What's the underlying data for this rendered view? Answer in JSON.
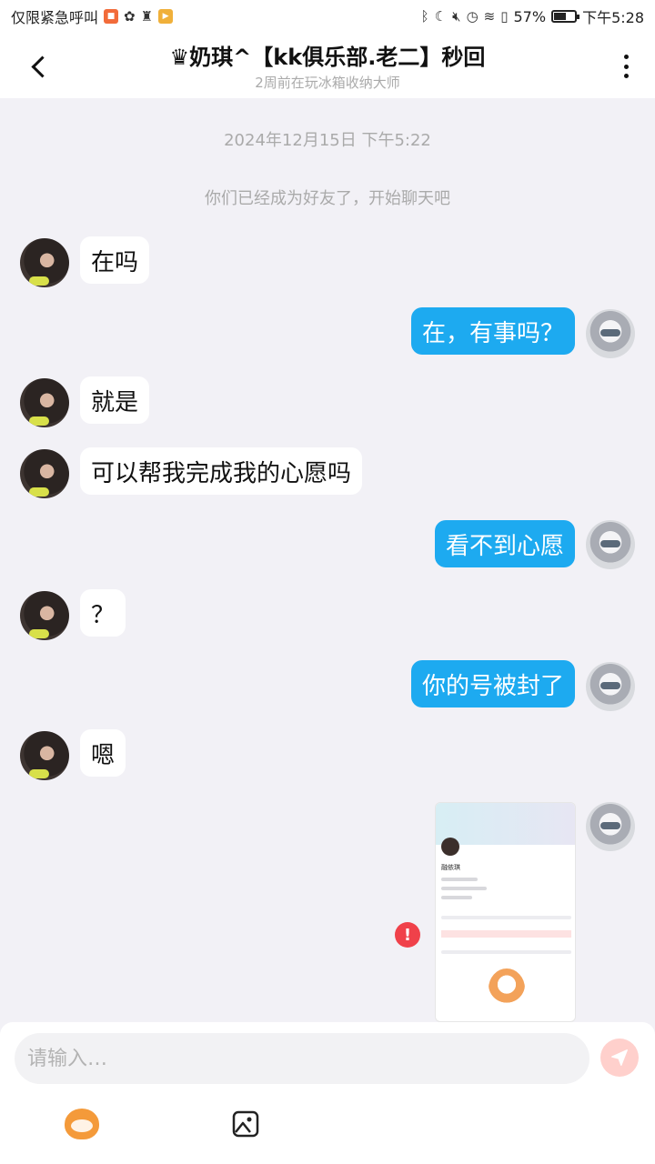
{
  "status_bar": {
    "left_text": "仅限紧急呼叫",
    "battery_percent": "57%",
    "battery_level": 0.57,
    "time": "下午5:28"
  },
  "header": {
    "title": "♛奶琪^【kk俱乐部.老二】秒回",
    "subtitle": "2周前在玩冰箱收纳大师"
  },
  "chat": {
    "timestamp": "2024年12月15日 下午5:22",
    "system_notice": "你们已经成为好友了，开始聊天吧",
    "messages": [
      {
        "from": "peer",
        "text": "在吗"
      },
      {
        "from": "me",
        "text": "在，有事吗？"
      },
      {
        "from": "peer",
        "text": "就是"
      },
      {
        "from": "peer",
        "text": "可以帮我完成我的心愿吗"
      },
      {
        "from": "me",
        "text": "看不到心愿"
      },
      {
        "from": "peer",
        "text": "？"
      },
      {
        "from": "me",
        "text": "你的号被封了"
      },
      {
        "from": "peer",
        "text": "嗯"
      }
    ],
    "image_message": {
      "profile_name": "融依琪",
      "error_icon": "!"
    }
  },
  "input": {
    "placeholder": "请输入…"
  },
  "colors": {
    "my_bubble": "#1daaf0",
    "peer_bubble": "#ffffff",
    "error": "#f0414a",
    "send_button": "#ffd0cc"
  },
  "icons": {
    "back": "chevron-left-icon",
    "more": "more-vertical-icon",
    "send": "send-icon",
    "emoji": "emoji-icon",
    "image": "image-icon"
  }
}
